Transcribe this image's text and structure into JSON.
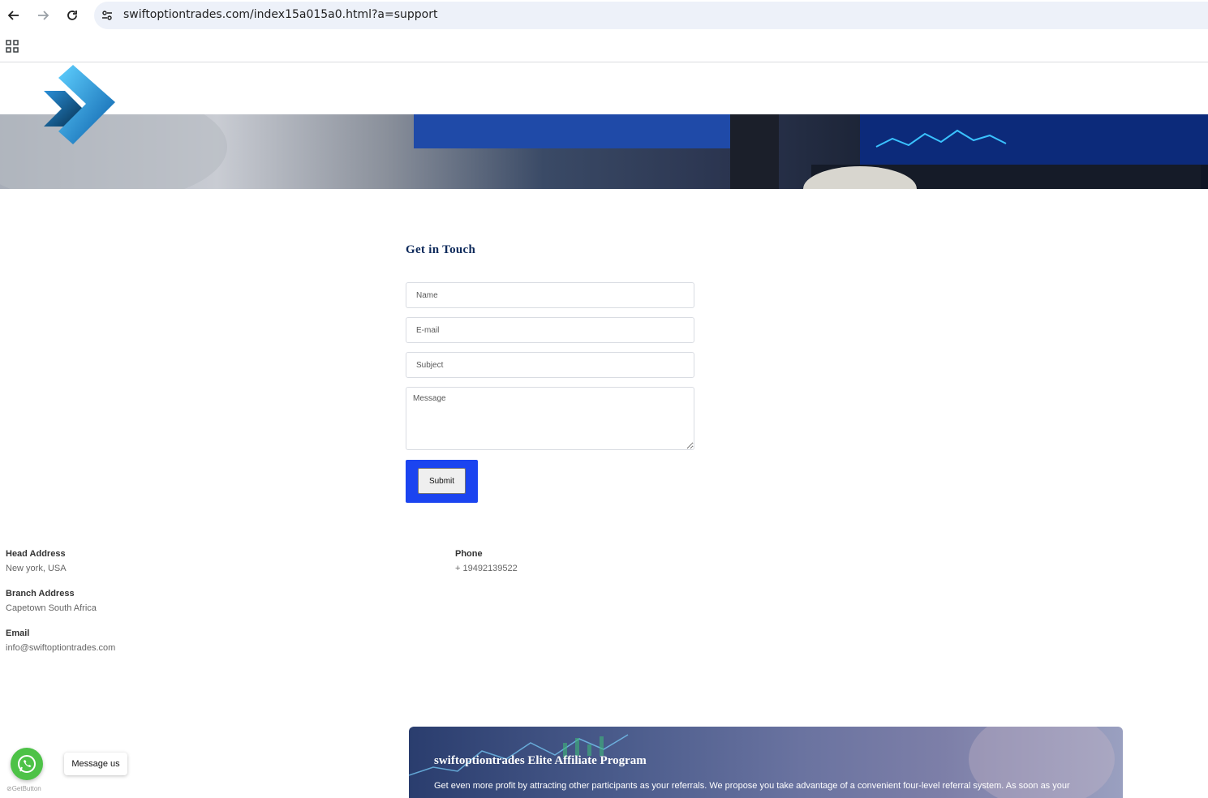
{
  "browser": {
    "url": "swiftoptiontrades.com/index15a015a0.html?a=support"
  },
  "contact_form": {
    "title": "Get in Touch",
    "name_placeholder": "Name",
    "email_placeholder": "E-mail",
    "subject_placeholder": "Subject",
    "message_placeholder": "Message",
    "submit_label": "Submit"
  },
  "contact_info": {
    "head_address_label": "Head Address",
    "head_address_value": "New york, USA",
    "branch_address_label": "Branch Address",
    "branch_address_value": "Capetown South Africa",
    "email_label": "Email",
    "email_value": "info@swiftoptiontrades.com",
    "phone_label": "Phone",
    "phone_value": "+ 19492139522"
  },
  "affiliate": {
    "title": "swiftoptiontrades Elite Affiliate Program",
    "text": "Get even more profit by attracting other participants as your referrals. We propose you take advantage of a convenient four-level referral system. As soon as your"
  },
  "whatsapp": {
    "label": "Message us",
    "credit": "GetButton"
  },
  "colors": {
    "submit_bg": "#1b44f0",
    "title_color": "#0e2a5b",
    "whatsapp_green": "#4dc247"
  }
}
